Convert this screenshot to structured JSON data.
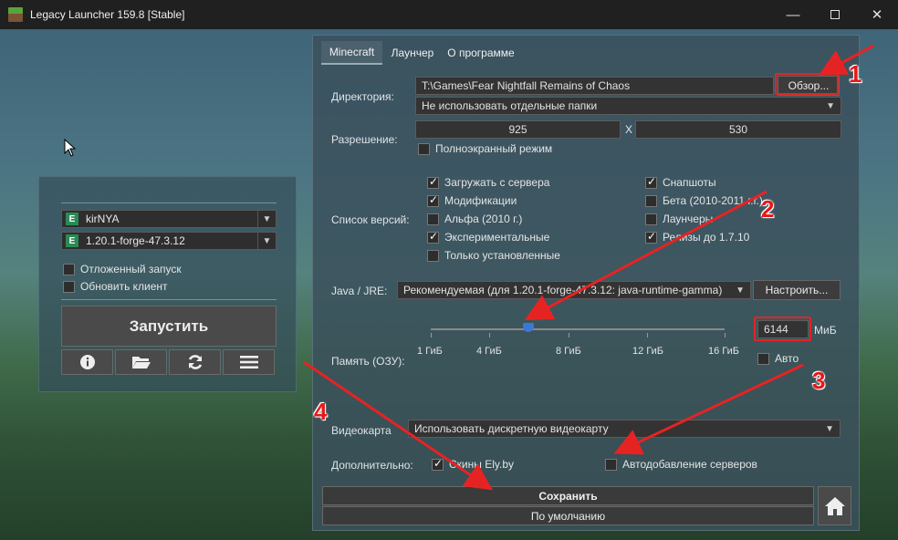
{
  "window": {
    "title": "Legacy Launcher 159.8 [Stable]"
  },
  "left_panel": {
    "account": {
      "badge": "E",
      "name": "kirNYA"
    },
    "version": {
      "badge": "E",
      "name": "1.20.1-forge-47.3.12"
    },
    "delayed_launch": {
      "label": "Отложенный запуск",
      "checked": false
    },
    "update_client": {
      "label": "Обновить клиент",
      "checked": false
    },
    "launch_label": "Запустить",
    "tools": [
      "info-icon",
      "folder-icon",
      "refresh-icon",
      "menu-icon"
    ]
  },
  "settings": {
    "tabs": [
      {
        "label": "Minecraft",
        "active": true
      },
      {
        "label": "Лаунчер",
        "active": false
      },
      {
        "label": "О программе",
        "active": false
      }
    ],
    "directory": {
      "label": "Директория:",
      "path": "T:\\Games\\Fear Nightfall Remains of Chaos",
      "browse_label": "Обзор...",
      "folders_mode": "Не использовать отдельные папки"
    },
    "resolution": {
      "label": "Разрешение:",
      "width": "925",
      "separator": "X",
      "height": "530",
      "fullscreen_label": "Полноэкранный режим",
      "fullscreen": false
    },
    "versions": {
      "label": "Список версий:",
      "items": [
        {
          "label": "Загружать с сервера",
          "checked": true
        },
        {
          "label": "Модификации",
          "checked": true
        },
        {
          "label": "Альфа (2010 г.)",
          "checked": false
        },
        {
          "label": "Экспериментальные",
          "checked": true
        },
        {
          "label": "Только установленные",
          "checked": false
        },
        {
          "label": "Снапшоты",
          "checked": true
        },
        {
          "label": "Бета (2010-2011 г.г.)",
          "checked": false
        },
        {
          "label": "Лаунчеры",
          "checked": false
        },
        {
          "label": "Релизы до 1.7.10",
          "checked": true
        }
      ]
    },
    "java": {
      "label": "Java / JRE:",
      "value": "Рекомендуемая (для 1.20.1-forge-47.3.12: java-runtime-gamma)",
      "configure_label": "Настроить..."
    },
    "memory": {
      "label": "Память (ОЗУ):",
      "value": "6144",
      "unit": "МиБ",
      "slider_fraction": 0.33,
      "ticks": [
        "1 ГиБ",
        "4 ГиБ",
        "8 ГиБ",
        "12 ГиБ",
        "16 ГиБ"
      ],
      "auto_label": "Авто",
      "auto": false
    },
    "gpu": {
      "label": "Видеокарта",
      "value": "Использовать дискретную видеокарту"
    },
    "extra": {
      "label": "Дополнительно:",
      "elyby": {
        "label": "Скины Ely.by",
        "checked": true
      },
      "autoservers": {
        "label": "Автодобавление серверов",
        "checked": false
      }
    },
    "save_label": "Сохранить",
    "default_label": "По умолчанию"
  },
  "annotations": {
    "n1": "1",
    "n2": "2",
    "n3": "3",
    "n4": "4",
    "color": "#e62323"
  },
  "colors": {
    "accent": "#3a78d8",
    "badge": "#2a8a56"
  }
}
